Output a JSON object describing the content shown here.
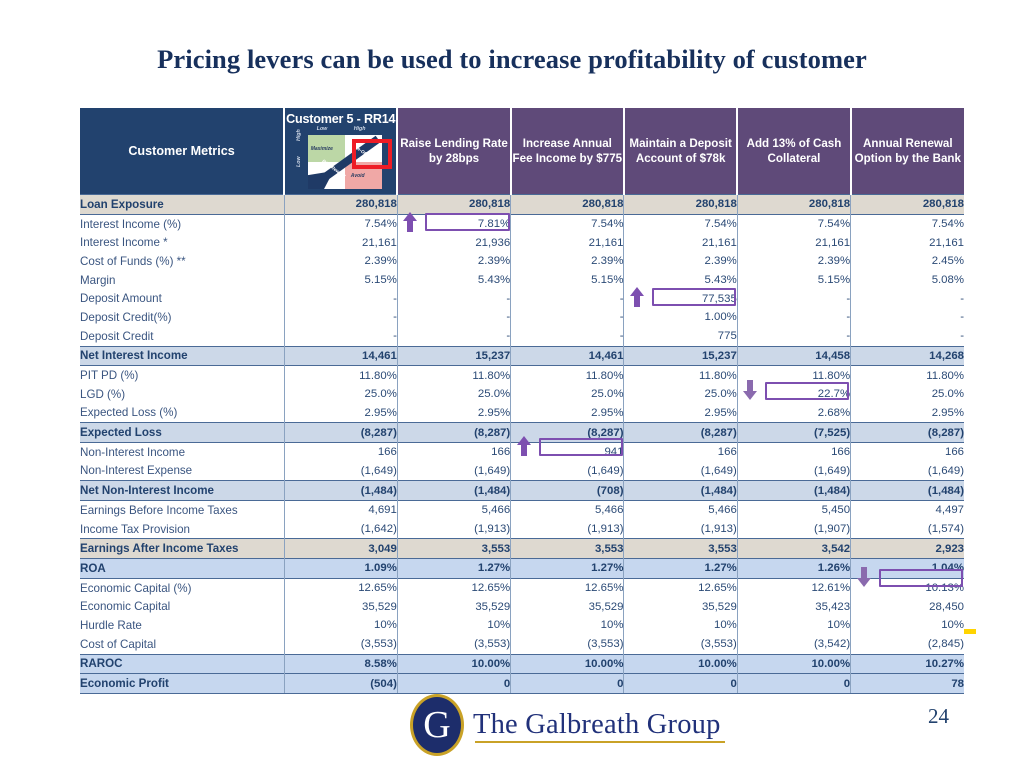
{
  "slide": {
    "title": "Pricing levers can be used to increase profitability of customer",
    "page_number": "24"
  },
  "brand": {
    "logo_letter": "G",
    "logo_text": "The Galbreath Group",
    "navy": "#22426e",
    "purple_header": "#5f4a79",
    "highlight_purple": "#7d4fb0",
    "gold": "#c9a227"
  },
  "table": {
    "metric_header": "Customer Metrics",
    "customer_header": "Customer 5 - RR14",
    "matrix": {
      "top_left_label": "Low",
      "top_right_label": "High",
      "left_top_label": "High",
      "left_bottom_label": "Low",
      "quadrant_maximize": "Maximize",
      "quadrant_avoid": "Avoid",
      "diagonal_label_upper": "Trade-Off",
      "diagonal_label_lower": "Risk/Reward"
    },
    "lever_headers": [
      "Raise Lending Rate by 28bps",
      "Increase Annual Fee Income by $775",
      "Maintain a Deposit Account of $78k",
      "Add 13% of Cash Collateral",
      "Annual Renewal Option by the Bank"
    ],
    "rows": [
      {
        "label": "Loan Exposure",
        "style": "band-beige",
        "values": [
          "280,818",
          "280,818",
          "280,818",
          "280,818",
          "280,818",
          "280,818"
        ]
      },
      {
        "label": "Interest Income (%)",
        "style": "band-white",
        "values": [
          "7.54%",
          "7.81%",
          "7.54%",
          "7.54%",
          "7.54%",
          "7.54%"
        ]
      },
      {
        "label": "Interest Income *",
        "style": "band-white",
        "values": [
          "21,161",
          "21,936",
          "21,161",
          "21,161",
          "21,161",
          "21,161"
        ]
      },
      {
        "label": "Cost of Funds (%) **",
        "style": "band-white",
        "values": [
          "2.39%",
          "2.39%",
          "2.39%",
          "2.39%",
          "2.39%",
          "2.45%"
        ]
      },
      {
        "label": "Margin",
        "style": "band-white",
        "values": [
          "5.15%",
          "5.43%",
          "5.15%",
          "5.43%",
          "5.15%",
          "5.08%"
        ]
      },
      {
        "label": "Deposit Amount",
        "style": "band-white",
        "values": [
          "-",
          "-",
          "-",
          "77,535",
          "-",
          "-"
        ]
      },
      {
        "label": "Deposit Credit(%)",
        "style": "band-white",
        "values": [
          "-",
          "-",
          "-",
          "1.00%",
          "-",
          "-"
        ]
      },
      {
        "label": "Deposit Credit",
        "style": "band-white",
        "values": [
          "-",
          "-",
          "-",
          "775",
          "-",
          "-"
        ]
      },
      {
        "label": "Net Interest Income",
        "style": "band-slate",
        "values": [
          "14,461",
          "15,237",
          "14,461",
          "15,237",
          "14,458",
          "14,268"
        ]
      },
      {
        "label": "PIT PD (%)",
        "style": "band-white",
        "values": [
          "11.80%",
          "11.80%",
          "11.80%",
          "11.80%",
          "11.80%",
          "11.80%"
        ]
      },
      {
        "label": "LGD (%)",
        "style": "band-white",
        "values": [
          "25.0%",
          "25.0%",
          "25.0%",
          "25.0%",
          "22.7%",
          "25.0%"
        ]
      },
      {
        "label": "Expected Loss (%)",
        "style": "band-white",
        "values": [
          "2.95%",
          "2.95%",
          "2.95%",
          "2.95%",
          "2.68%",
          "2.95%"
        ]
      },
      {
        "label": "Expected Loss",
        "style": "band-slate",
        "values": [
          "(8,287)",
          "(8,287)",
          "(8,287)",
          "(8,287)",
          "(7,525)",
          "(8,287)"
        ]
      },
      {
        "label": "Non-Interest Income",
        "style": "band-white",
        "values": [
          "166",
          "166",
          "941",
          "166",
          "166",
          "166"
        ]
      },
      {
        "label": "Non-Interest Expense",
        "style": "band-white",
        "values": [
          "(1,649)",
          "(1,649)",
          "(1,649)",
          "(1,649)",
          "(1,649)",
          "(1,649)"
        ]
      },
      {
        "label": "Net Non-Interest Income",
        "style": "band-slate",
        "values": [
          "(1,484)",
          "(1,484)",
          "(708)",
          "(1,484)",
          "(1,484)",
          "(1,484)"
        ]
      },
      {
        "label": "Earnings Before Income Taxes",
        "style": "band-white",
        "values": [
          "4,691",
          "5,466",
          "5,466",
          "5,466",
          "5,450",
          "4,497"
        ]
      },
      {
        "label": "Income Tax Provision",
        "style": "band-white",
        "values": [
          "(1,642)",
          "(1,913)",
          "(1,913)",
          "(1,913)",
          "(1,907)",
          "(1,574)"
        ]
      },
      {
        "label": "Earnings After Income Taxes",
        "style": "band-beige",
        "values": [
          "3,049",
          "3,553",
          "3,553",
          "3,553",
          "3,542",
          "2,923"
        ]
      },
      {
        "label": "ROA",
        "style": "band-blue",
        "values": [
          "1.09%",
          "1.27%",
          "1.27%",
          "1.27%",
          "1.26%",
          "1.04%"
        ]
      },
      {
        "label": "Economic Capital (%)",
        "style": "band-white",
        "values": [
          "12.65%",
          "12.65%",
          "12.65%",
          "12.65%",
          "12.61%",
          "10.13%"
        ]
      },
      {
        "label": "Economic Capital",
        "style": "band-white",
        "values": [
          "35,529",
          "35,529",
          "35,529",
          "35,529",
          "35,423",
          "28,450"
        ]
      },
      {
        "label": "Hurdle Rate",
        "style": "band-white",
        "values": [
          "10%",
          "10%",
          "10%",
          "10%",
          "10%",
          "10%"
        ]
      },
      {
        "label": "Cost of Capital",
        "style": "band-white",
        "values": [
          "(3,553)",
          "(3,553)",
          "(3,553)",
          "(3,553)",
          "(3,542)",
          "(2,845)"
        ]
      },
      {
        "label": "RAROC",
        "style": "band-blue",
        "values": [
          "8.58%",
          "10.00%",
          "10.00%",
          "10.00%",
          "10.00%",
          "10.27%"
        ]
      },
      {
        "label": "Economic Profit",
        "style": "band-blue",
        "values": [
          "(504)",
          "0",
          "0",
          "0",
          "0",
          "78"
        ]
      }
    ],
    "callouts": [
      {
        "name": "interest-income-pct-lever1",
        "value": "7.81%",
        "direction": "up",
        "row": 1,
        "col": 1
      },
      {
        "name": "deposit-amount-lever3",
        "value": "77,535",
        "direction": "up",
        "row": 5,
        "col": 3
      },
      {
        "name": "lgd-lever4",
        "value": "22.7%",
        "direction": "down",
        "row": 10,
        "col": 4
      },
      {
        "name": "non-interest-income-lever2",
        "value": "941",
        "direction": "up",
        "row": 13,
        "col": 2
      },
      {
        "name": "economic-capital-pct-lever5",
        "value": "10.13%",
        "direction": "down",
        "row": 20,
        "col": 5
      }
    ]
  }
}
